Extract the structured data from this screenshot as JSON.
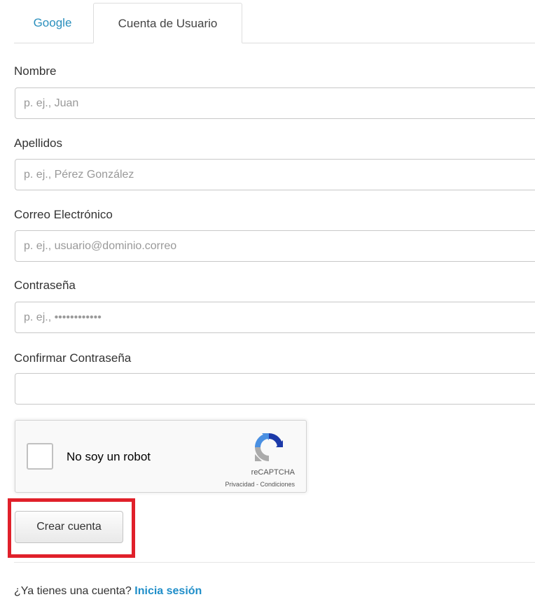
{
  "tabs": [
    {
      "label": "Google"
    },
    {
      "label": "Cuenta de Usuario"
    }
  ],
  "form": {
    "nombre": {
      "label": "Nombre",
      "placeholder": "p. ej., Juan"
    },
    "apellidos": {
      "label": "Apellidos",
      "placeholder": "p. ej., Pérez González"
    },
    "correo": {
      "label": "Correo Electrónico",
      "placeholder": "p. ej., usuario@dominio.correo"
    },
    "contrasena": {
      "label": "Contraseña",
      "placeholder": "p. ej., ••••••••••••"
    },
    "confirmar": {
      "label": "Confirmar Contraseña",
      "placeholder": ""
    }
  },
  "recaptcha": {
    "label": "No soy un robot",
    "brand": "reCAPTCHA",
    "links": "Privacidad - Condiciones"
  },
  "create_button_label": "Crear cuenta",
  "footer": {
    "question": "¿Ya tienes una cuenta?",
    "link": "Inicia sesión"
  },
  "colors": {
    "tab_link": "#2a8fbd",
    "highlight": "#e0202a",
    "footer_link": "#1f8ec9"
  }
}
